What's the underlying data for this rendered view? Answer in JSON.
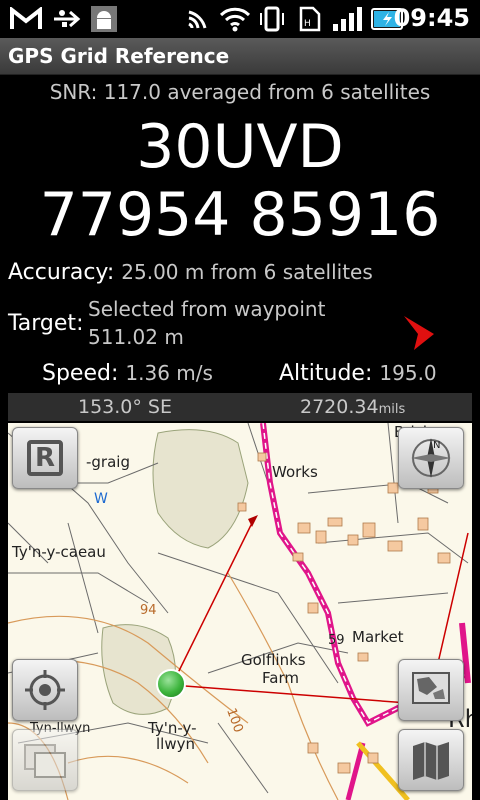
{
  "status_bar": {
    "time": "09:45",
    "icons": [
      "gmail-icon",
      "usb-icon",
      "android-debug-icon",
      "nfc-icon",
      "wifi-icon",
      "vibrate-icon",
      "sim-icon",
      "signal-icon",
      "battery-charging-icon"
    ]
  },
  "app": {
    "title": "GPS Grid Reference"
  },
  "snr_text": "SNR: 117.0 averaged from 6 satellites",
  "grid_ref": {
    "zone": "30UVD",
    "coords": "77954 85916"
  },
  "accuracy": {
    "label": "Accuracy:",
    "value": "25.00 m from 6 satellites"
  },
  "target": {
    "label": "Target:",
    "line1": "Selected from waypoint",
    "line2": "511.02 m"
  },
  "speed": {
    "label": "Speed:",
    "value": "1.36 m/s"
  },
  "altitude": {
    "label": "Altitude:",
    "value": "195.0"
  },
  "bearing": {
    "degrees": "153.0° SE",
    "mils_value": "2720.34",
    "mils_unit": "mils"
  },
  "map": {
    "labels": {
      "graig": "-graig",
      "works": "Works",
      "brick": "Brick",
      "tyn_y_caeau": "Ty'n-y-caeau",
      "golflinks": "Golflinks",
      "farm": "Farm",
      "market": "Market",
      "num59": "59",
      "num94": "94",
      "num100": "100",
      "tynyllwyn_1": "Ty'n-y-",
      "tynyllwyn_2": "llwyn",
      "tynllwyn": "Tyn-llwyn",
      "rh": "Rh",
      "w": "W",
      "r_button": "R"
    },
    "colors": {
      "route": "#e0158a",
      "line": "#cc0000",
      "position": "#3cb43c"
    }
  }
}
